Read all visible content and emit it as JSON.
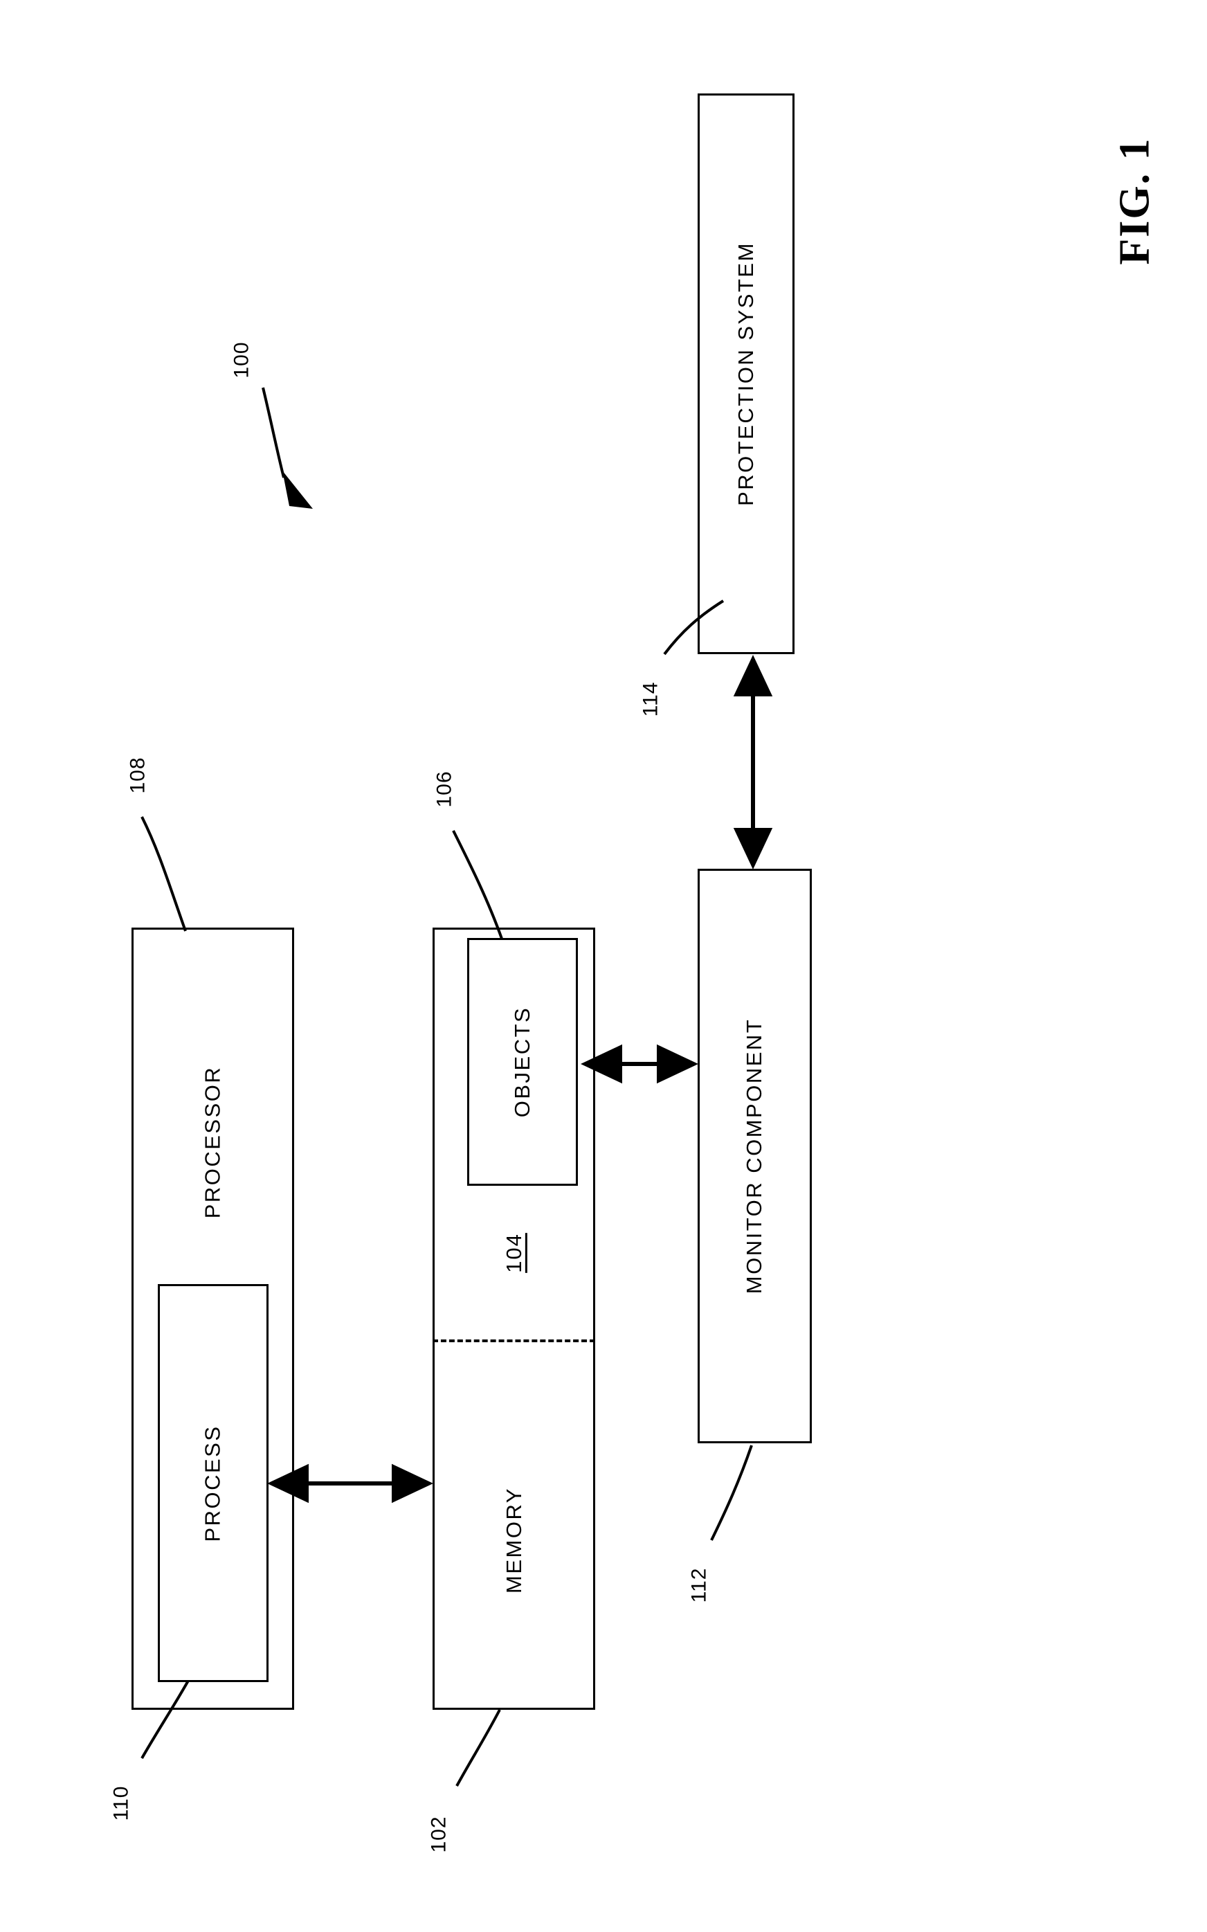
{
  "figure": {
    "title": "FIG. 1",
    "system_reference": "100"
  },
  "blocks": [
    {
      "id": "processor",
      "label": "PROCESSOR",
      "reference": "108"
    },
    {
      "id": "process",
      "label": "PROCESS",
      "reference": "110"
    },
    {
      "id": "memory",
      "label": "MEMORY",
      "reference": "102"
    },
    {
      "id": "memory-section",
      "label": "104",
      "reference": "104"
    },
    {
      "id": "objects",
      "label": "OBJECTS",
      "reference": "106"
    },
    {
      "id": "monitor-component",
      "label": "MONITOR COMPONENT",
      "reference": "112"
    },
    {
      "id": "protection-system",
      "label": "PROTECTION SYSTEM",
      "reference": "114"
    }
  ],
  "connectors": [
    {
      "id": "process-to-memory",
      "from": "process",
      "to": "memory",
      "type": "double-arrow"
    },
    {
      "id": "objects-to-monitor",
      "from": "objects",
      "to": "monitor-component",
      "type": "double-arrow"
    },
    {
      "id": "monitor-to-protection",
      "from": "monitor-component",
      "to": "protection-system",
      "type": "double-arrow"
    }
  ]
}
